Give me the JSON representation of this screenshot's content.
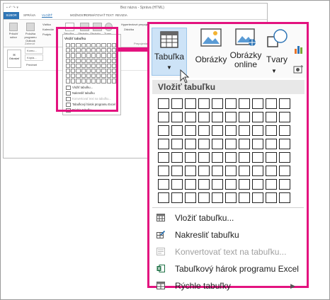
{
  "background_window": {
    "title": "Bez názvu - Správa (HTML)",
    "tabs": [
      "SÚBOR",
      "SPRÁVA",
      "VLOŽIŤ",
      "MOŽNOSTI",
      "FORMÁTOVAŤ TEXT",
      "REVIZIA"
    ],
    "ribbon": {
      "attach_file": "Priložiť súbor",
      "attach_item": "Položka programu Outlook",
      "business_card": "Vizitka",
      "calendar": "Kalendár",
      "signature": "Podpis",
      "group_include": "Zahrnúť",
      "table": "Tabuľka",
      "pictures": "Obrázky",
      "online_pictures": "Obrázky online",
      "shapes": "Tvary",
      "hyperlink": "Hypertextové prepojenie",
      "bookmark": "Záložka",
      "group_links": "Prepojenia"
    },
    "header_fields": {
      "send": "Odoslať",
      "to": "Komu...",
      "cc": "Kópia...",
      "subject": "Predmet"
    },
    "mini_dropdown": {
      "heading": "Vložiť tabuľku",
      "items": [
        "Vložiť tabuľku...",
        "Nakresliť tabuľku",
        "Konvertovať text na tabuľku...",
        "Tabuľkový hárok programu Excel",
        "Rýchle tabuľky"
      ]
    }
  },
  "ribbon": {
    "table_label": "Tabuľka",
    "pictures_label": "Obrázky",
    "online_pictures_label_line1": "Obrázky",
    "online_pictures_label_line2": "online",
    "shapes_label": "Tvary"
  },
  "dropdown": {
    "heading": "Vložiť tabuľku",
    "grid": {
      "columns": 10,
      "rows": 8
    },
    "items": [
      {
        "label": "Vložiť tabuľku...",
        "icon": "table-icon",
        "enabled": true,
        "submenu": false
      },
      {
        "label": "Nakresliť tabuľku",
        "icon": "draw-table-icon",
        "enabled": true,
        "submenu": false
      },
      {
        "label": "Konvertovať text na tabuľku...",
        "icon": "convert-text-icon",
        "enabled": false,
        "submenu": false
      },
      {
        "label": "Tabuľkový hárok programu Excel",
        "icon": "excel-icon",
        "enabled": true,
        "submenu": false
      },
      {
        "label": "Rýchle tabuľky",
        "icon": "quick-tables-icon",
        "enabled": true,
        "submenu": true
      }
    ]
  },
  "colors": {
    "highlight_border": "#e3127f",
    "file_tab": "#2e75b6",
    "selected_button": "#cde3f7",
    "excel_green": "#1e7145"
  }
}
